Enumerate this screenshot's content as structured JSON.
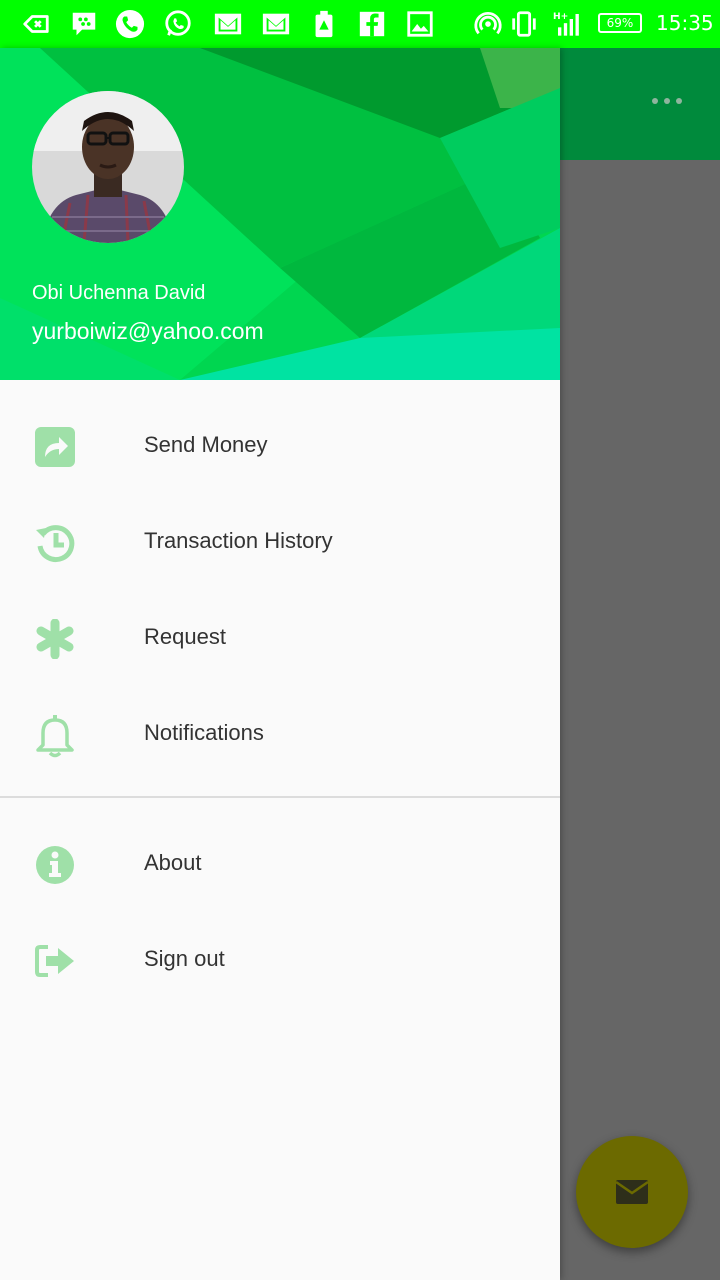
{
  "status_bar": {
    "battery": "69%",
    "time": "15:35",
    "network": "H+",
    "icons": [
      "back-arrow-icon",
      "bbm-icon",
      "phone-icon",
      "whatsapp-icon",
      "gmail-icon",
      "gmail-icon",
      "alert-file-icon",
      "facebook-icon",
      "image-icon",
      "hotspot-icon",
      "vibrate-icon",
      "signal-icon"
    ]
  },
  "drawer": {
    "user_name": "Obi Uchenna David",
    "user_email": "yurboiwiz@yahoo.com",
    "menu": [
      {
        "label": "Send Money",
        "icon": "share-icon"
      },
      {
        "label": "Transaction History",
        "icon": "history-icon"
      },
      {
        "label": "Request",
        "icon": "asterisk-icon"
      },
      {
        "label": "Notifications",
        "icon": "bell-icon"
      }
    ],
    "menu_secondary": [
      {
        "label": "About",
        "icon": "info-icon"
      },
      {
        "label": "Sign out",
        "icon": "sign-out-icon"
      }
    ]
  },
  "colors": {
    "status_bar": "#00ff00",
    "header_green": "#00c853",
    "icon_green": "#9fe0a8",
    "app_bar": "#008a3c",
    "fab": "#6c6a00"
  }
}
